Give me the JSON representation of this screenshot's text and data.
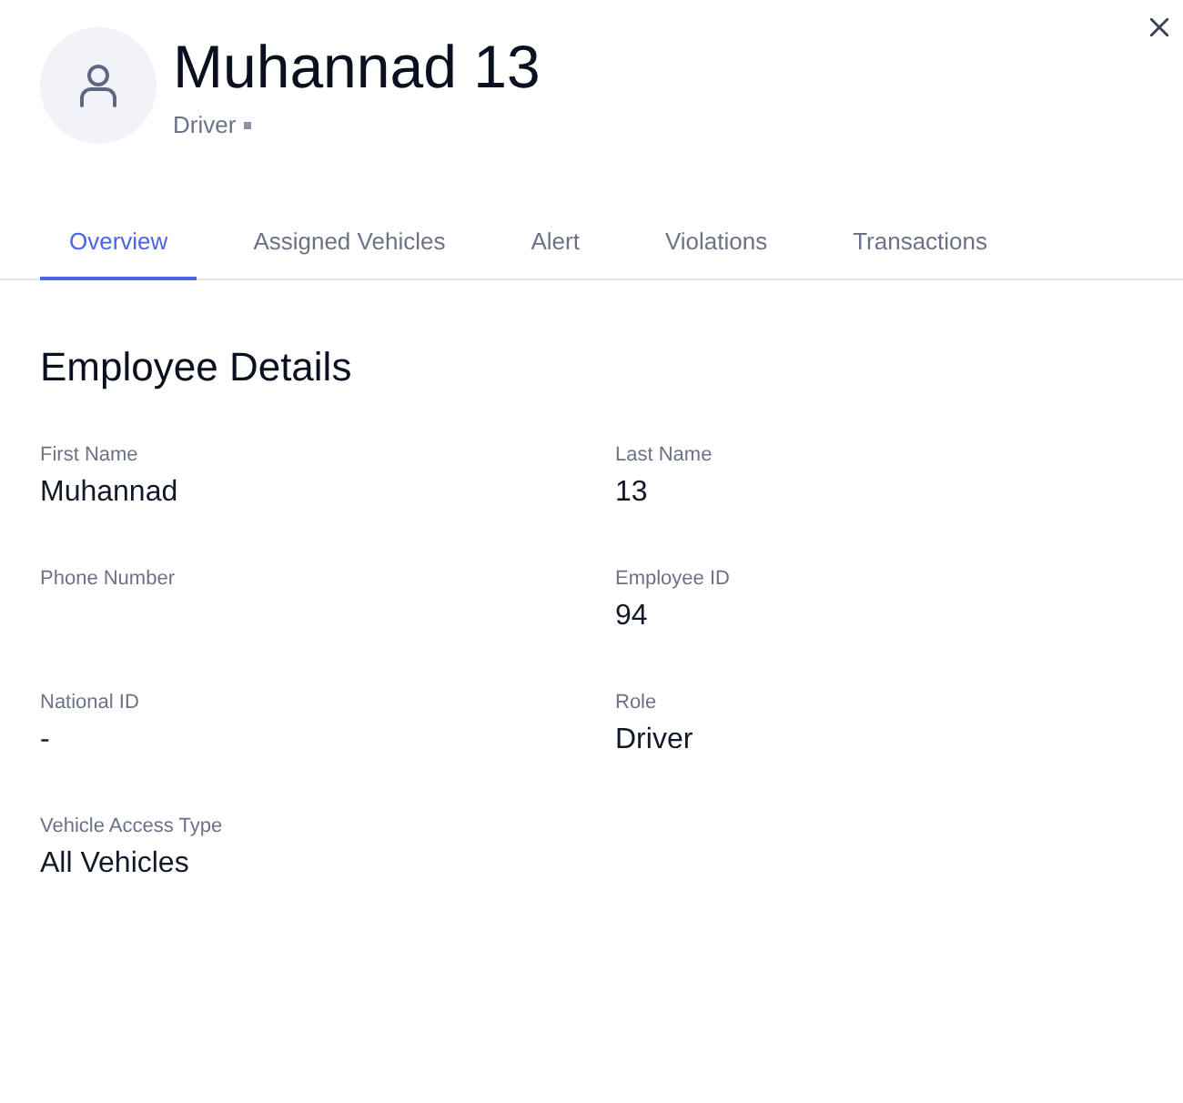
{
  "header": {
    "name": "Muhannad 13",
    "role": "Driver"
  },
  "tabs": [
    {
      "label": "Overview",
      "selected": true
    },
    {
      "label": "Assigned Vehicles",
      "selected": false
    },
    {
      "label": "Alert",
      "selected": false
    },
    {
      "label": "Violations",
      "selected": false
    },
    {
      "label": "Transactions",
      "selected": false
    }
  ],
  "section": {
    "title": "Employee Details",
    "fields": [
      {
        "label": "First Name",
        "value": "Muhannad"
      },
      {
        "label": "Last Name",
        "value": "13"
      },
      {
        "label": "Phone Number"
      },
      {
        "label": "Employee ID",
        "value": "94"
      },
      {
        "label": "National ID",
        "value": "-"
      },
      {
        "label": "Role",
        "value": "Driver"
      },
      {
        "label": "Vehicle Access Type",
        "value": "All Vehicles"
      }
    ]
  }
}
